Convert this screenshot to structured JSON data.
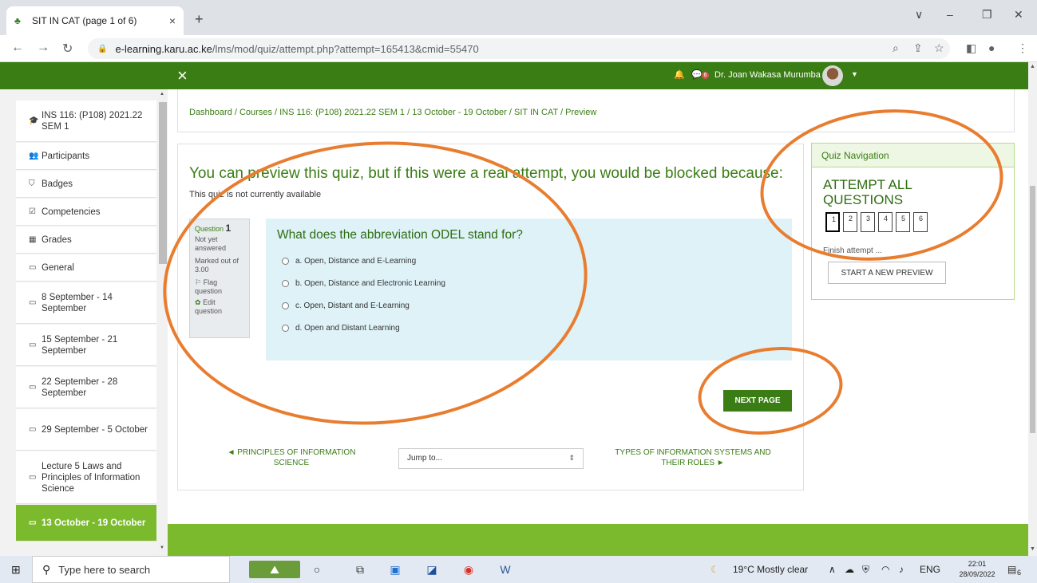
{
  "browser": {
    "tab_title": "SIT IN CAT (page 1 of 6)",
    "tab_close": "×",
    "new_tab": "+",
    "url_host": "e-learning.karu.ac.ke",
    "url_path": "/lms/mod/quiz/attempt.php?attempt=165413&cmid=55470",
    "window_minimize": "–",
    "window_maximize": "❐",
    "window_close": "✕",
    "tab_menu": "∨"
  },
  "moodle_header": {
    "close": "×",
    "user_name": "Dr. Joan Wakasa Murumba",
    "message_count": "6"
  },
  "sidebar": {
    "items": [
      {
        "icon": "🎓",
        "label": "INS 116: (P108) 2021.22 SEM 1"
      },
      {
        "icon": "👥",
        "label": "Participants"
      },
      {
        "icon": "⛉",
        "label": "Badges"
      },
      {
        "icon": "☑",
        "label": "Competencies"
      },
      {
        "icon": "▦",
        "label": "Grades"
      },
      {
        "icon": "▭",
        "label": "General"
      },
      {
        "icon": "▭",
        "label": "8 September - 14 September"
      },
      {
        "icon": "▭",
        "label": "15 September - 21 September"
      },
      {
        "icon": "▭",
        "label": "22 September - 28 September"
      },
      {
        "icon": "▭",
        "label": "29 September - 5 October"
      },
      {
        "icon": "▭",
        "label": "Lecture 5 Laws and Principles of Information Science"
      },
      {
        "icon": "▭",
        "label": "13 October - 19 October"
      }
    ]
  },
  "breadcrumb": "Dashboard / Courses / INS 116: (P108) 2021.22 SEM 1 / 13 October - 19 October / SIT IN CAT / Preview",
  "quiz": {
    "preview_heading": "You can preview this quiz, but if this were a real attempt, you would be blocked because:",
    "preview_reason": "This quiz is not currently available",
    "question_label": "Question",
    "question_number": "1",
    "status": "Not yet answered",
    "marked": "Marked out of 3.00",
    "flag": "Flag question",
    "edit": "Edit question",
    "question_text": "What does the abbreviation ODEL stand for?",
    "options": [
      "a. Open, Distance and E-Learning",
      "b. Open, Distance and Electronic Learning",
      "c. Open, Distant and E-Learning",
      "d. Open and Distant Learning"
    ],
    "next_page": "NEXT PAGE",
    "prev_activity": "◄ PRINCIPLES OF INFORMATION SCIENCE",
    "next_activity": "TYPES OF INFORMATION SYSTEMS AND THEIR ROLES ►",
    "jump_to": "Jump to..."
  },
  "quiz_nav": {
    "header": "Quiz Navigation",
    "title": "ATTEMPT ALL QUESTIONS",
    "buttons": [
      "1",
      "2",
      "3",
      "4",
      "5",
      "6"
    ],
    "finish": "Finish attempt ...",
    "start_new_preview": "START A NEW PREVIEW"
  },
  "taskbar": {
    "search_placeholder": "Type here to search",
    "weather": "19°C  Mostly clear",
    "language": "ENG",
    "time": "22:01",
    "date": "28/09/2022",
    "notification_count": "6"
  },
  "colors": {
    "moodle_green": "#3a7d14",
    "light_green": "#7bba2d",
    "annotation_orange": "#e97d2f"
  }
}
